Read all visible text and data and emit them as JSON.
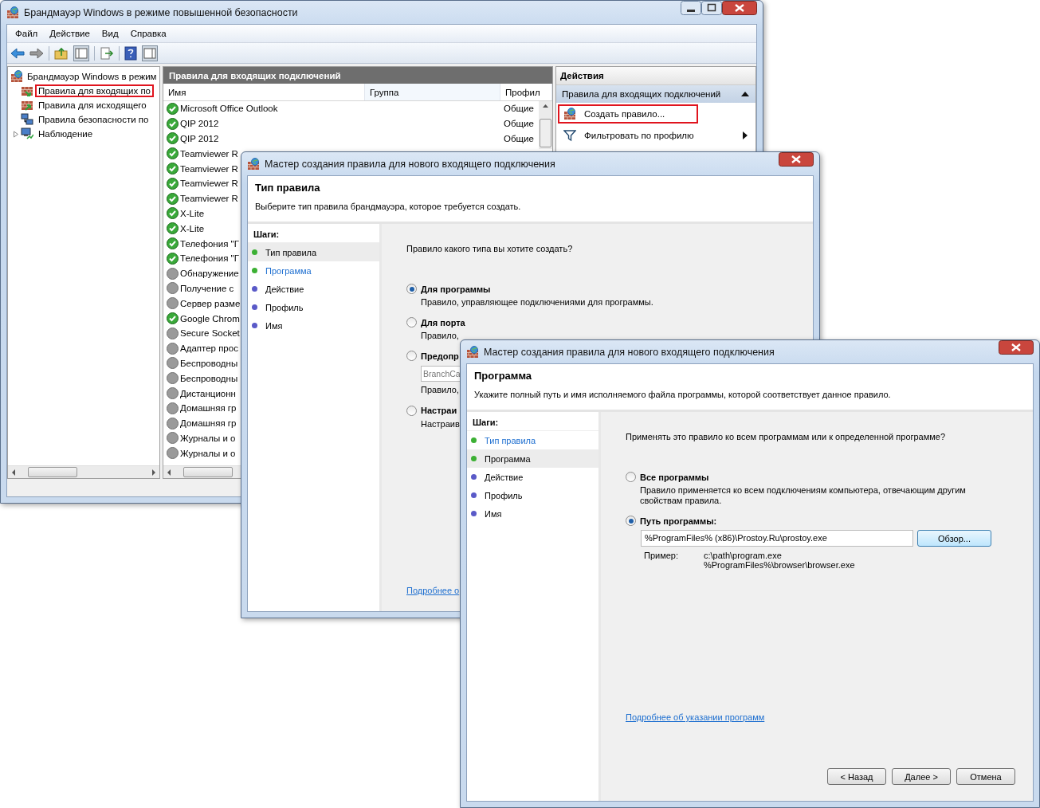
{
  "main_window": {
    "title": "Брандмауэр Windows в режиме повышенной безопасности",
    "menu": [
      "Файл",
      "Действие",
      "Вид",
      "Справка"
    ],
    "tree": {
      "label": "Брандмауэр Windows в режим",
      "children": [
        {
          "label": "Правила для входящих по",
          "kind": "inbound",
          "highlighted": true
        },
        {
          "label": "Правила для исходящего",
          "kind": "outbound",
          "highlighted": false
        },
        {
          "label": "Правила безопасности по",
          "kind": "security",
          "highlighted": false
        },
        {
          "label": "Наблюдение",
          "kind": "monitor",
          "highlighted": false,
          "expanded": false
        }
      ]
    },
    "rules_pane": {
      "title": "Правила для входящих подключений",
      "columns": [
        "Имя",
        "Группа",
        "Профил"
      ],
      "rows": [
        {
          "name": "Microsoft Office Outlook",
          "enabled": true,
          "profile": "Общие"
        },
        {
          "name": "QIP 2012",
          "enabled": true,
          "profile": "Общие"
        },
        {
          "name": "QIP 2012",
          "enabled": true,
          "profile": "Общие"
        },
        {
          "name": "Teamviewer R",
          "enabled": true
        },
        {
          "name": "Teamviewer R",
          "enabled": true
        },
        {
          "name": "Teamviewer R",
          "enabled": true
        },
        {
          "name": "Teamviewer R",
          "enabled": true
        },
        {
          "name": "X-Lite",
          "enabled": true
        },
        {
          "name": "X-Lite",
          "enabled": true
        },
        {
          "name": "Телефония \"Г",
          "enabled": true
        },
        {
          "name": "Телефония \"Г",
          "enabled": true
        },
        {
          "name": "Обнаружение",
          "enabled": false
        },
        {
          "name": "Получение с",
          "enabled": false
        },
        {
          "name": "Сервер разме",
          "enabled": false
        },
        {
          "name": "Google Chrom",
          "enabled": true
        },
        {
          "name": "Secure Socket",
          "enabled": false
        },
        {
          "name": "Адаптер прос",
          "enabled": false
        },
        {
          "name": "Беспроводны",
          "enabled": false
        },
        {
          "name": "Беспроводны",
          "enabled": false
        },
        {
          "name": "Дистанционн",
          "enabled": false
        },
        {
          "name": "Домашняя гр",
          "enabled": false
        },
        {
          "name": "Домашняя гр",
          "enabled": false
        },
        {
          "name": "Журналы и о",
          "enabled": false
        },
        {
          "name": "Журналы и о",
          "enabled": false
        }
      ]
    },
    "actions": {
      "title": "Действия",
      "group": {
        "label": "Правила для входящих подключений",
        "expanded": true
      },
      "items": [
        {
          "label": "Создать правило...",
          "kind": "new-rule",
          "highlighted": true
        },
        {
          "label": "Фильтровать по профилю",
          "kind": "filter",
          "highlighted": false
        }
      ]
    }
  },
  "wizards": [
    {
      "title": "Мастер создания правила для нового входящего подключения",
      "heading": "Тип правила",
      "subtitle": "Выберите тип правила брандмауэра, которое требуется создать.",
      "steps_label": "Шаги:",
      "steps": [
        {
          "label": "Тип правила",
          "selected": true,
          "link": false,
          "color": "#3cb034"
        },
        {
          "label": "Программа",
          "selected": false,
          "link": true,
          "color": "#3cb034"
        },
        {
          "label": "Действие",
          "selected": false,
          "link": false,
          "color": "#5a5ac8"
        },
        {
          "label": "Профиль",
          "selected": false,
          "link": false,
          "color": "#5a5ac8"
        },
        {
          "label": "Имя",
          "selected": false,
          "link": false,
          "color": "#5a5ac8"
        }
      ],
      "question": "Правило какого типа вы хотите создать?",
      "options": [
        {
          "label": "Для программы",
          "selected": true,
          "description": "Правило, управляющее подключениями для программы."
        },
        {
          "label": "Для порта",
          "selected": false,
          "description": "Правило,"
        },
        {
          "label": "Предопр",
          "selected": false,
          "field": "BranchCa",
          "description": "Правило,"
        },
        {
          "label": "Настраи",
          "selected": false,
          "description": "Настраив"
        }
      ],
      "link": "Подробнее о"
    },
    {
      "title": "Мастер создания правила для нового входящего подключения",
      "heading": "Программа",
      "subtitle": "Укажите полный путь и имя исполняемого файла программы, которой соответствует данное правило.",
      "steps_label": "Шаги:",
      "steps": [
        {
          "label": "Тип правила",
          "selected": false,
          "link": true,
          "color": "#3cb034"
        },
        {
          "label": "Программа",
          "selected": true,
          "link": false,
          "color": "#3cb034"
        },
        {
          "label": "Действие",
          "selected": false,
          "link": false,
          "color": "#5a5ac8"
        },
        {
          "label": "Профиль",
          "selected": false,
          "link": false,
          "color": "#5a5ac8"
        },
        {
          "label": "Имя",
          "selected": false,
          "link": false,
          "color": "#5a5ac8"
        }
      ],
      "question": "Применять это правило ко всем программам или к определенной программе?",
      "options": [
        {
          "label": "Все программы",
          "selected": false,
          "description": "Правило применяется ко всем подключениям компьютера, отвечающим другим свойствам правила."
        },
        {
          "label": "Путь программы:",
          "selected": true,
          "path": "%ProgramFiles% (x86)\\Prostoy.Ru\\prostoy.exe",
          "browse": "Обзор...",
          "example_label": "Пример:",
          "examples": [
            "c:\\path\\program.exe",
            "%ProgramFiles%\\browser\\browser.exe"
          ]
        }
      ],
      "link": "Подробнее об указании программ",
      "buttons": [
        "< Назад",
        "Далее >",
        "Отмена"
      ]
    }
  ]
}
